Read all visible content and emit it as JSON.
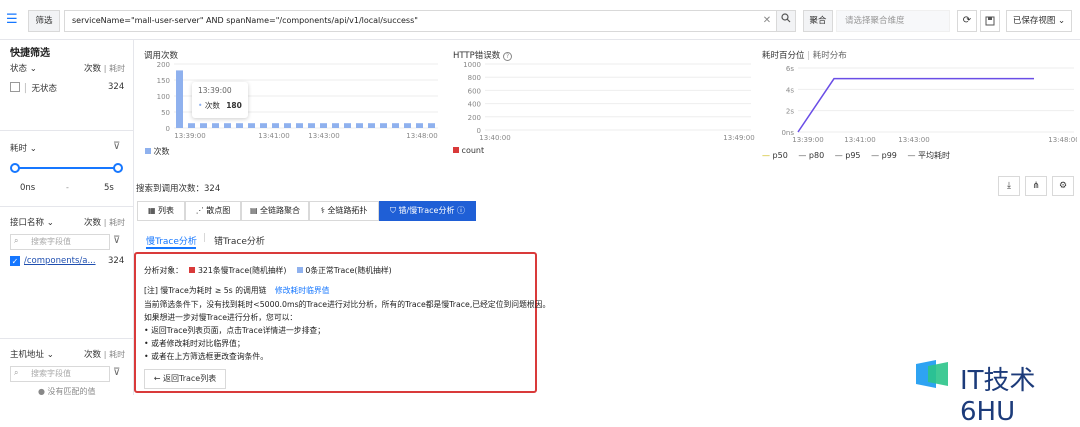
{
  "topbar": {
    "filter_label": "筛选",
    "query": "serviceName=\"mall-user-server\" AND spanName=\"/components/api/v1/local/success\"",
    "agg_label": "聚合",
    "agg_placeholder": "请选择聚合维度",
    "saved_view": "已保存视图"
  },
  "sidebar": {
    "quick_filter": "快捷筛选",
    "status_section": {
      "title": "状态",
      "count_label": "次数",
      "duration_label": "耗时",
      "items": [
        {
          "label": "无状态",
          "count": "324"
        }
      ]
    },
    "duration_section": {
      "title": "耗时",
      "min": "0ns",
      "sep": "-",
      "max": "5s"
    },
    "api_section": {
      "title": "接口名称",
      "count_label": "次数",
      "duration_label": "耗时",
      "search_placeholder": "搜索字段值",
      "items": [
        {
          "label": "/components/a...",
          "count": "324"
        }
      ]
    },
    "host_section": {
      "title": "主机地址",
      "count_label": "次数",
      "duration_label": "耗时",
      "search_placeholder": "搜索字段值",
      "empty": "没有匹配的值"
    }
  },
  "charts": {
    "calls": {
      "title": "调用次数",
      "legend": "次数"
    },
    "errors": {
      "title": "HTTP错误数",
      "legend": "count"
    },
    "latency": {
      "title": "耗时百分位",
      "subtitle": "耗时分布",
      "legend": [
        "p50",
        "p80",
        "p95",
        "p99",
        "平均耗时"
      ]
    }
  },
  "chart_data": [
    {
      "type": "bar",
      "title": "调用次数",
      "yticks": [
        "200",
        "150",
        "100",
        "50",
        "0"
      ],
      "xticks": [
        "13:39:00",
        "13:41:00",
        "13:43:00",
        "13:48:00"
      ],
      "ylim": [
        0,
        200
      ],
      "series": [
        {
          "name": "次数",
          "values": [
            180,
            15,
            15,
            15,
            15,
            15,
            15,
            15,
            15,
            15,
            15,
            15,
            15,
            15,
            15,
            15,
            15,
            15,
            15,
            15,
            15,
            15
          ]
        }
      ],
      "tooltip": {
        "time": "13:39:00",
        "label": "次数",
        "value": "180"
      },
      "grid": true
    },
    {
      "type": "line",
      "title": "HTTP错误数",
      "yticks": [
        "1000",
        "800",
        "600",
        "400",
        "200",
        "0"
      ],
      "xticks": [
        "13:40:00",
        "13:49:00"
      ],
      "ylim": [
        0,
        1000
      ],
      "series": [
        {
          "name": "count",
          "values": []
        }
      ],
      "grid": true
    },
    {
      "type": "line",
      "title": "耗时百分位",
      "yticks": [
        "6s",
        "4s",
        "2s",
        "0ns"
      ],
      "xticks": [
        "13:39:00",
        "13:41:00",
        "13:43:00",
        "13:48:00"
      ],
      "ylim": [
        0,
        6
      ],
      "series": [
        {
          "name": "p50",
          "values": [
            0,
            5,
            5,
            5,
            5,
            5,
            5
          ]
        }
      ],
      "grid": true
    }
  ],
  "summary": {
    "found_calls": "搜索到调用次数：324"
  },
  "tabs": [
    {
      "label": "列表"
    },
    {
      "label": "散点图"
    },
    {
      "label": "全链路聚合"
    },
    {
      "label": "全链路拓扑"
    },
    {
      "label": "错/慢Trace分析"
    }
  ],
  "subtabs": {
    "slow": "慢Trace分析",
    "error": "错Trace分析"
  },
  "panel": {
    "target_label": "分析对象：",
    "slow_sample": "321条慢Trace(随机抽样)",
    "normal_sample": "0条正常Trace(随机抽样)",
    "note": "[注] 慢Trace为耗时 ≥ 5s 的调用链",
    "modify_link": "修改耗时临界值",
    "line1": "当前筛选条件下，没有找到耗时<5000.0ms的Trace进行对比分析，所有的Trace都是慢Trace,已经定位到问题根因。",
    "line2": "如果想进一步对慢Trace进行分析，您可以：",
    "bullets": [
      "返回Trace列表页面，点击Trace详情进一步排查；",
      "或者修改耗时对比临界值；",
      "或者在上方筛选框更改查询条件。"
    ],
    "back_button": "返回Trace列表"
  },
  "watermark": "IT技术6HU",
  "colors": {
    "accent": "#1677ff",
    "bar": "#8fb1ee",
    "line": "#6a4ee6",
    "error": "#d93a3a"
  }
}
